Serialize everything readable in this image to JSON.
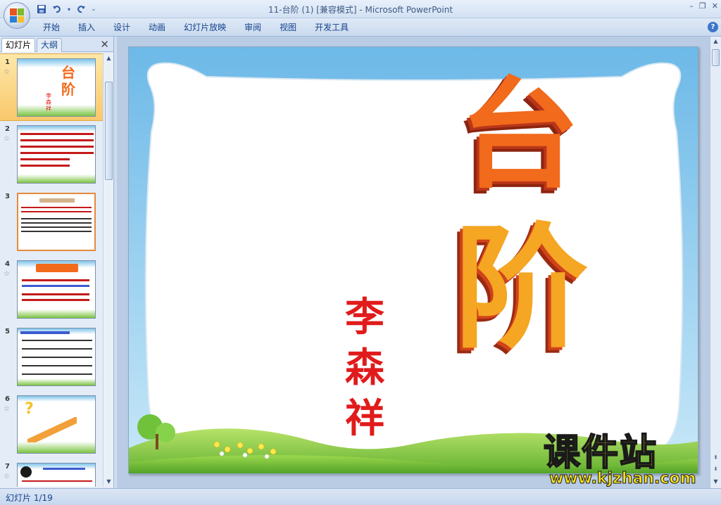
{
  "window": {
    "title": "11-台阶 (1) [兼容模式] - Microsoft PowerPoint",
    "minimize": "–",
    "restore": "❐",
    "close": "✕"
  },
  "ribbon": {
    "tabs": [
      "开始",
      "插入",
      "设计",
      "动画",
      "幻灯片放映",
      "审阅",
      "视图",
      "开发工具"
    ],
    "help": "?"
  },
  "left_pane": {
    "tab_slides": "幻灯片",
    "tab_outline": "大纲",
    "close": "✕",
    "thumbnails": [
      {
        "num": "1"
      },
      {
        "num": "2"
      },
      {
        "num": "3"
      },
      {
        "num": "4"
      },
      {
        "num": "5"
      },
      {
        "num": "6"
      },
      {
        "num": "7"
      }
    ]
  },
  "slide": {
    "title": "台阶",
    "title_char1": "台",
    "title_char2": "阶",
    "author": "李森祥",
    "author_chars": [
      "李",
      "森",
      "祥"
    ]
  },
  "status": {
    "text": "幻灯片 1/19"
  },
  "watermark": {
    "brand": "课件站",
    "url": "www.kjzhan.com"
  },
  "colors": {
    "accent": "#15428b",
    "title_orange": "#f26a1b",
    "author_red": "#e11b1b",
    "selected_thumb": "#f9c86c"
  }
}
